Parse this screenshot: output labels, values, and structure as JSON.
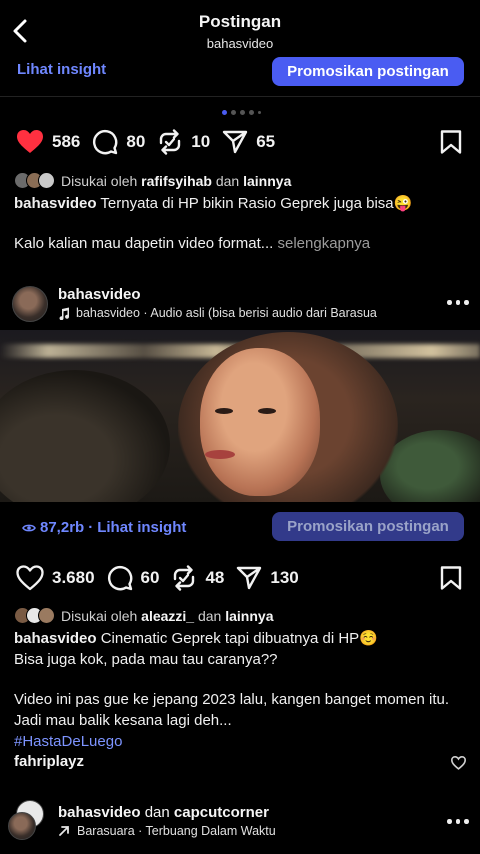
{
  "header": {
    "title": "Postingan",
    "subtitle": "bahasvideo",
    "back_icon": "chevron-left-icon"
  },
  "top_bar": {
    "insight_link": "Lihat insight",
    "promote_button": "Promosikan postingan"
  },
  "colors": {
    "accent": "#4a5cf2",
    "like_red": "#ff3040",
    "link_blue": "#6f87ff"
  },
  "carousel": {
    "total_dots": 5,
    "active_index": 0
  },
  "post1": {
    "likes": "586",
    "comments": "80",
    "reposts": "10",
    "shares": "65",
    "liked": true,
    "liked_by_prefix": "Disukai oleh",
    "liked_by_user": "rafifsyihab",
    "liked_by_and": "dan",
    "liked_by_others": "lainnya",
    "caption_user": "bahasvideo",
    "caption_text": " Ternyata di HP bikin Rasio Geprek juga bisa😜",
    "caption_line2": "Kalo kalian mau dapetin video format...",
    "more_label": " selengkapnya"
  },
  "post2": {
    "author": "bahasvideo",
    "audio": "bahasvideo · Audio asli  (bisa berisi audio dari Barasua",
    "views": "87,2rb",
    "views_sep": " · ",
    "insight_link": "Lihat insight",
    "promote_button": "Promosikan postingan",
    "likes": "3.680",
    "comments": "60",
    "reposts": "48",
    "shares": "130",
    "liked_by_prefix": "Disukai oleh",
    "liked_by_user": "aleazzi_",
    "liked_by_and": "dan",
    "liked_by_others": "lainnya",
    "caption_user": "bahasvideo",
    "caption_text": " Cinematic Geprek tapi dibuatnya di HP☺️",
    "caption_line2": "Bisa juga kok, pada mau tau caranya??",
    "caption_line3": "Video ini pas gue ke jepang 2023 lalu, kangen banget momen itu. Jadi mau balik kesana lagi deh...",
    "hashtag": "#HastaDeLuego",
    "top_comment_user": "fahriplayz"
  },
  "post3": {
    "author": "bahasvideo",
    "author_and": "dan",
    "coauthor": "capcutcorner",
    "audio": "Barasuara · Terbuang Dalam Waktu"
  }
}
